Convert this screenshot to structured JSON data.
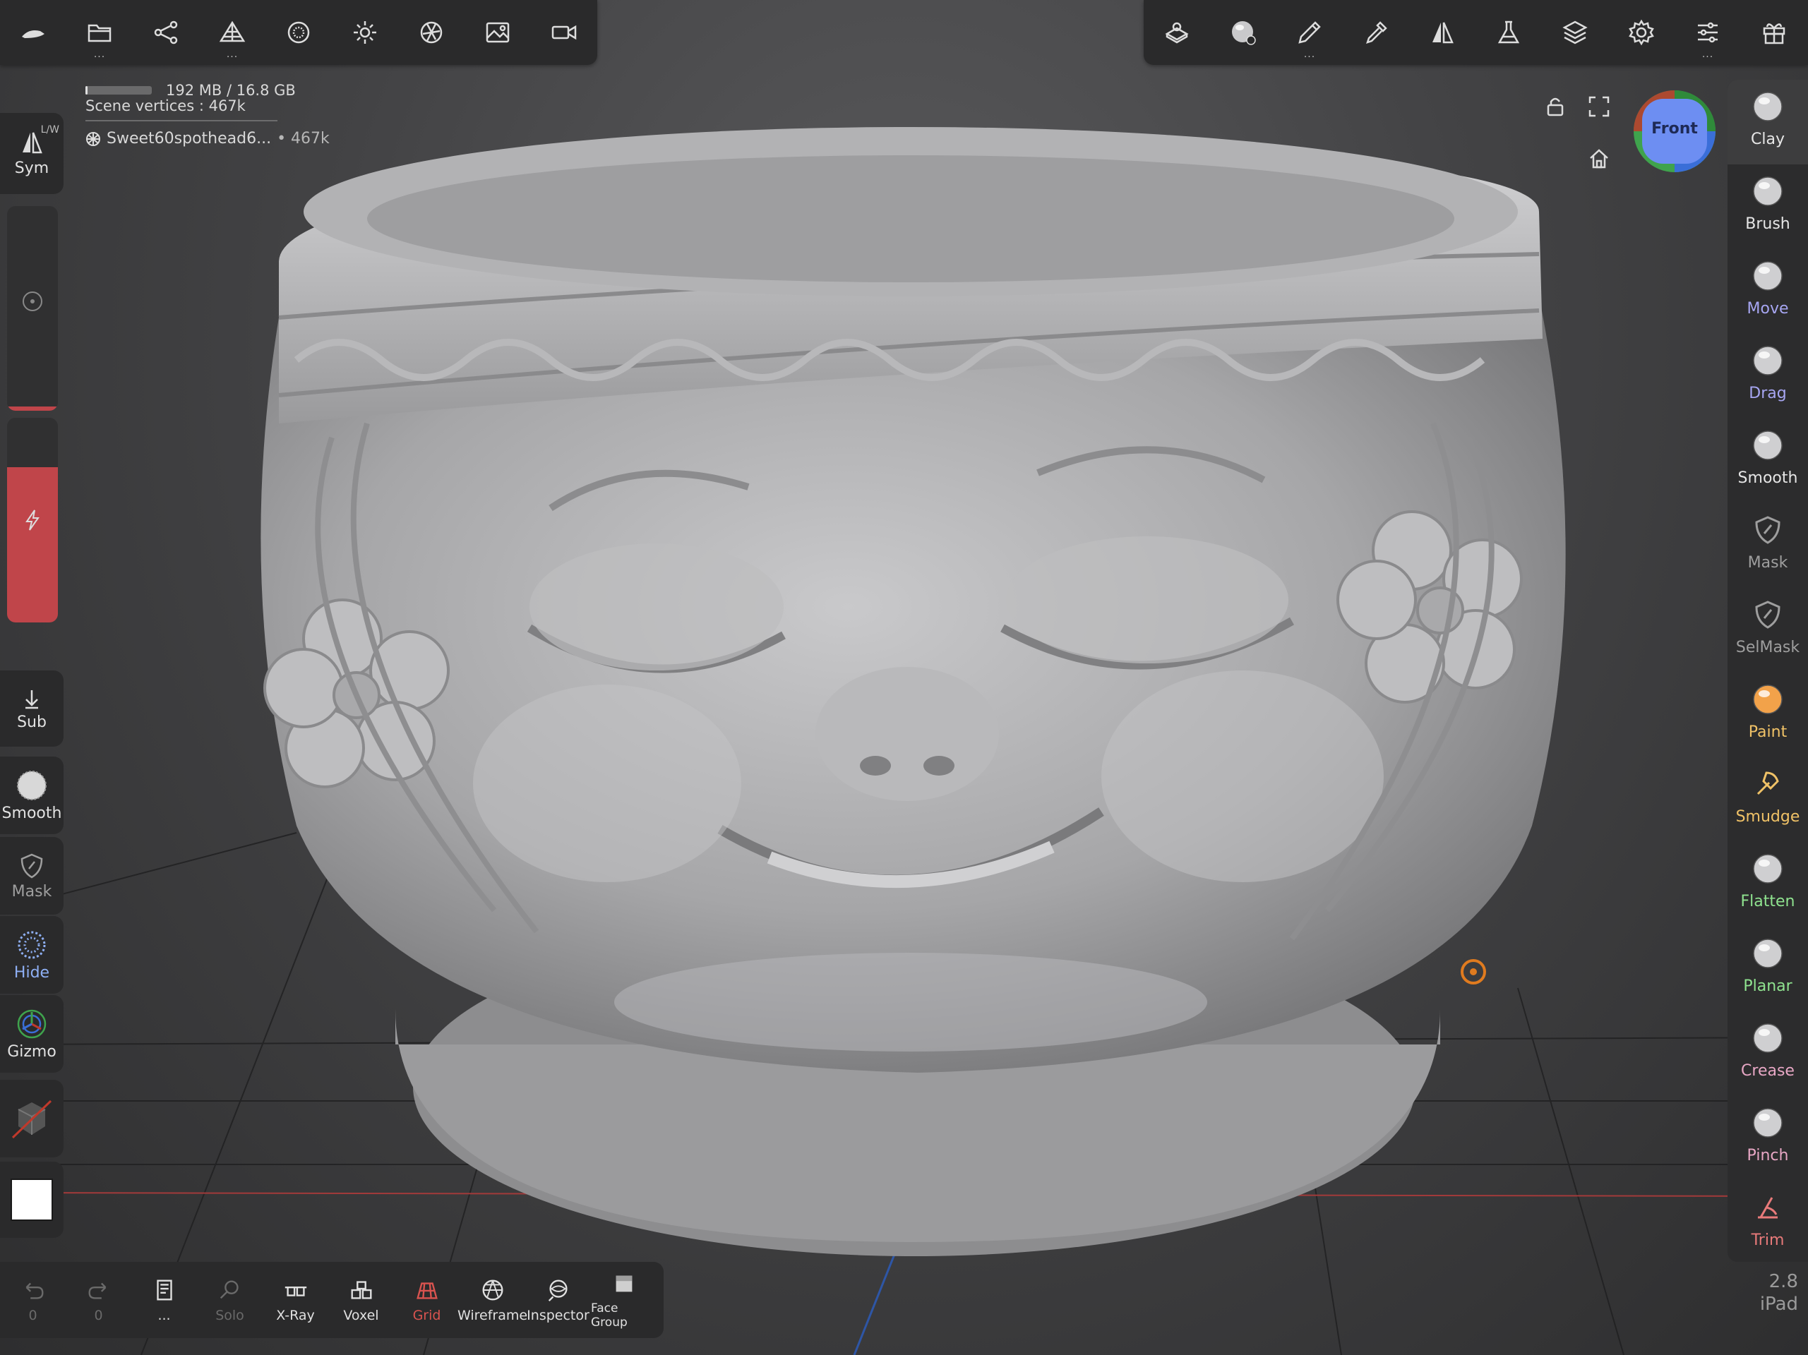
{
  "info": {
    "memory": "192 MB / 16.8 GB",
    "memory_used_fraction": 0.012,
    "vertices": "Scene vertices : 467k",
    "object_name": "Sweet60spothead6...",
    "object_meta": "• 467k"
  },
  "top_left_tools": [
    {
      "icon": "nomad-logo-icon",
      "dots": false
    },
    {
      "icon": "folder-icon",
      "dots": true
    },
    {
      "icon": "scene-graph-icon",
      "dots": false
    },
    {
      "icon": "topology-icon",
      "dots": true
    },
    {
      "icon": "material-sphere-icon",
      "dots": false
    },
    {
      "icon": "sun-icon",
      "dots": false
    },
    {
      "icon": "aperture-icon",
      "dots": false
    },
    {
      "icon": "image-icon",
      "dots": false
    },
    {
      "icon": "video-camera-icon",
      "dots": false
    }
  ],
  "top_right_tools": [
    {
      "icon": "scene-settings-icon",
      "dots": false
    },
    {
      "icon": "matcap-sphere-icon",
      "dots": false
    },
    {
      "icon": "brush-pen-icon",
      "dots": true
    },
    {
      "icon": "eyedropper-icon",
      "dots": false
    },
    {
      "icon": "symmetry-icon",
      "dots": false
    },
    {
      "icon": "flask-icon",
      "dots": false
    },
    {
      "icon": "layers-icon",
      "dots": false
    },
    {
      "icon": "gear-icon",
      "dots": false
    },
    {
      "icon": "sliders-icon",
      "dots": true
    },
    {
      "icon": "gift-icon",
      "dots": false
    }
  ],
  "viewcube": {
    "label": "Front"
  },
  "left": {
    "sym_label": "Sym",
    "sym_mode": "L/W",
    "sub_label": "Sub",
    "smooth_label": "Smooth",
    "mask_label": "Mask",
    "hide_label": "Hide",
    "gizmo_label": "Gizmo",
    "radius_level": 0.02,
    "intensity_level": 0.76
  },
  "right_tools": [
    {
      "label": "Clay",
      "color": "#e6e6e6",
      "icon": "clay-sphere-icon",
      "active": true
    },
    {
      "label": "Brush",
      "color": "#e6e6e6",
      "icon": "brush-sphere-icon"
    },
    {
      "label": "Move",
      "color": "#a7a6f2",
      "icon": "move-sphere-icon"
    },
    {
      "label": "Drag",
      "color": "#a7a6f2",
      "icon": "drag-sphere-icon"
    },
    {
      "label": "Smooth",
      "color": "#e6e6e6",
      "icon": "smooth-sphere-icon"
    },
    {
      "label": "Mask",
      "color": "#9e9e9e",
      "icon": "mask-icon"
    },
    {
      "label": "SelMask",
      "color": "#9e9e9e",
      "icon": "selmask-icon"
    },
    {
      "label": "Paint",
      "color": "#f0c267",
      "icon": "paint-sphere-icon"
    },
    {
      "label": "Smudge",
      "color": "#f0c267",
      "icon": "smudge-icon"
    },
    {
      "label": "Flatten",
      "color": "#8fe38f",
      "icon": "flatten-sphere-icon"
    },
    {
      "label": "Planar",
      "color": "#8fe38f",
      "icon": "planar-sphere-icon"
    },
    {
      "label": "Crease",
      "color": "#e8a7c5",
      "icon": "crease-sphere-icon"
    },
    {
      "label": "Pinch",
      "color": "#e8a7c5",
      "icon": "pinch-sphere-icon"
    },
    {
      "label": "Trim",
      "color": "#e87a7a",
      "icon": "trim-icon"
    }
  ],
  "bottom": [
    {
      "label": "0",
      "icon": "undo-icon",
      "disabled": true
    },
    {
      "label": "0",
      "icon": "redo-icon",
      "disabled": true
    },
    {
      "label": "...",
      "icon": "history-doc-icon"
    },
    {
      "label": "Solo",
      "icon": "solo-search-icon",
      "disabled": true
    },
    {
      "label": "X-Ray",
      "icon": "xray-glasses-icon"
    },
    {
      "label": "Voxel",
      "icon": "voxel-cubes-icon"
    },
    {
      "label": "Grid",
      "icon": "grid-icon",
      "accent": "#d9534f"
    },
    {
      "label": "Wireframe",
      "icon": "wireframe-icon"
    },
    {
      "label": "Inspector",
      "icon": "inspector-icon"
    },
    {
      "label": "Face Group",
      "icon": "face-group-icon"
    }
  ],
  "version": {
    "number": "2.8",
    "device": "iPad"
  }
}
